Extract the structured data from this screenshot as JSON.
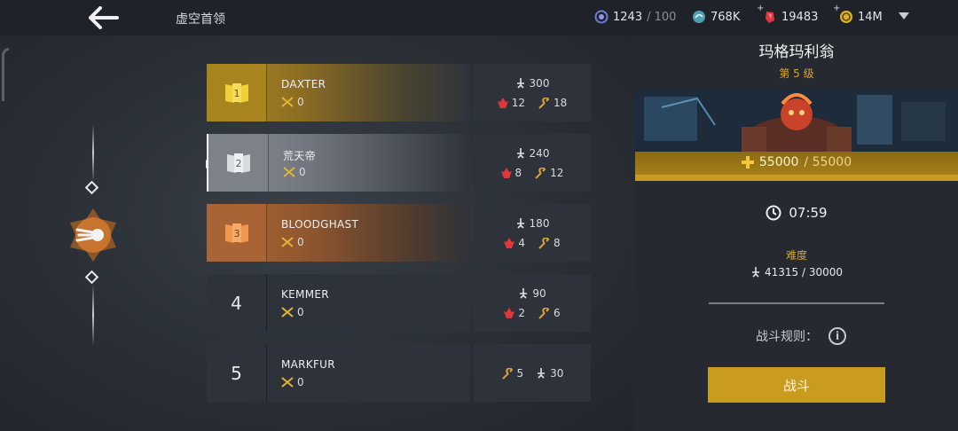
{
  "header": {
    "title": "虚空首领",
    "resources": [
      {
        "icon": "void-crystal-icon",
        "value": "1243",
        "suffix": "/ 100",
        "has_plus": false
      },
      {
        "icon": "energy-orb-icon",
        "value": "768K",
        "suffix": "",
        "has_plus": false
      },
      {
        "icon": "red-gem-icon",
        "value": "19483",
        "suffix": "",
        "has_plus": true
      },
      {
        "icon": "gold-coin-icon",
        "value": "14M",
        "suffix": "",
        "has_plus": true
      }
    ]
  },
  "leaderboard": [
    {
      "rank": "1",
      "name": "DAXTER",
      "kills": "0",
      "power": "300",
      "stat_a": "12",
      "stat_b": "18",
      "style": "gold"
    },
    {
      "rank": "2",
      "name": "荒天帝",
      "kills": "0",
      "power": "240",
      "stat_a": "8",
      "stat_b": "12",
      "style": "silver"
    },
    {
      "rank": "3",
      "name": "BLOODGHAST",
      "kills": "0",
      "power": "180",
      "stat_a": "4",
      "stat_b": "8",
      "style": "bronze"
    },
    {
      "rank": "4",
      "name": "KEMMER",
      "kills": "0",
      "power": "90",
      "stat_a": "2",
      "stat_b": "6",
      "style": "plain"
    },
    {
      "rank": "5",
      "name": "MARKFUR",
      "kills": "0",
      "power": "30",
      "stat_a": "",
      "stat_b": "5",
      "style": "plain"
    }
  ],
  "boss": {
    "name": "玛格玛利翁",
    "level": "第 5 级",
    "hp_current": "55000",
    "hp_max": "/ 55000",
    "hp_fraction": 1.0,
    "timer": "07:59",
    "difficulty_label": "难度",
    "difficulty_value": "41315 / 30000",
    "rules_label": "战斗规则：",
    "battle_label": "战斗"
  },
  "colors": {
    "gold": "#c99b1e",
    "silver": "#7d8289",
    "bronze": "#a86434",
    "accent_text": "#d9a52a",
    "red_gem": "#e0383a"
  }
}
